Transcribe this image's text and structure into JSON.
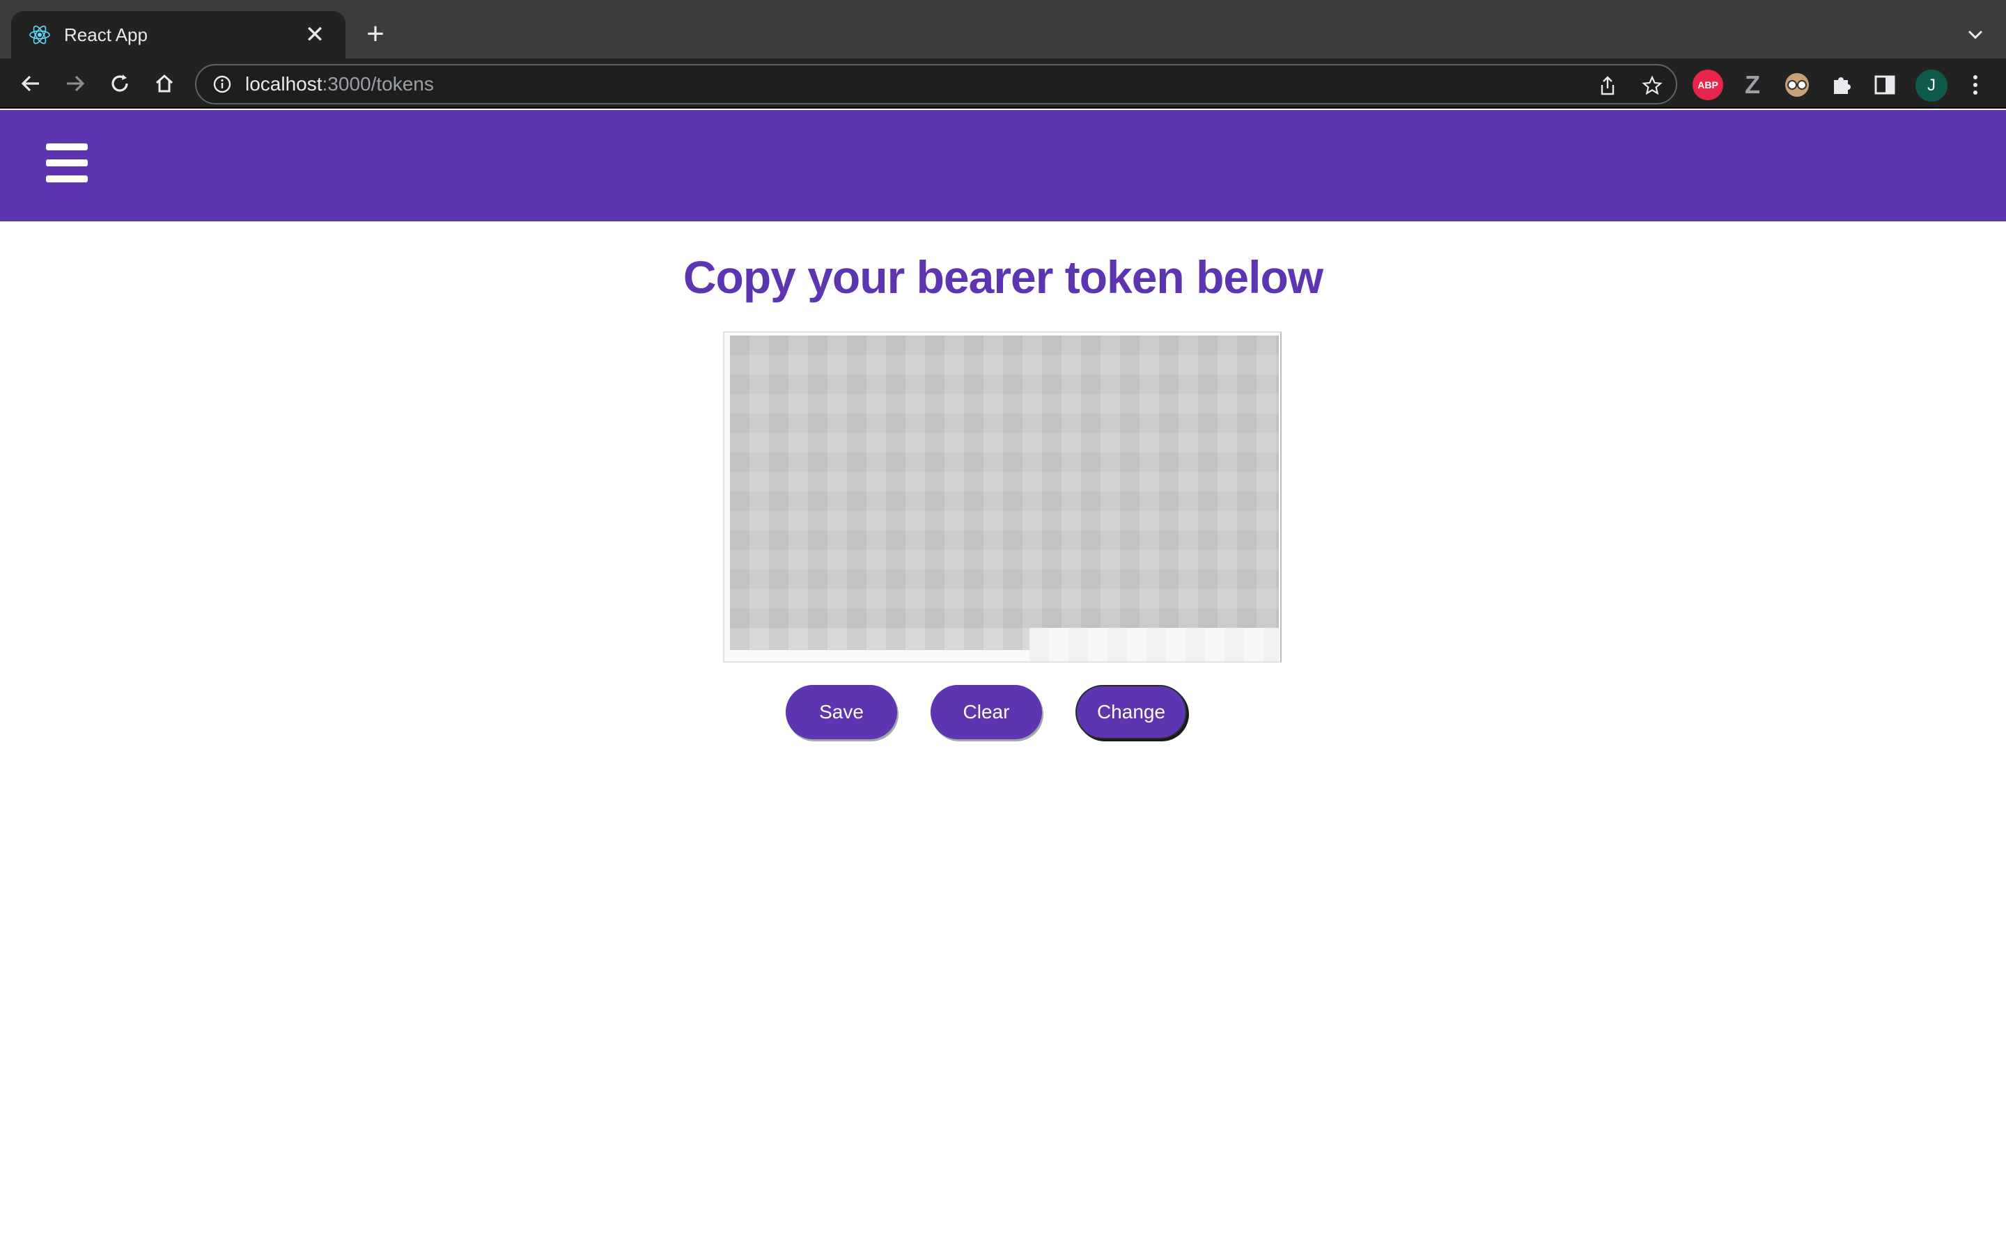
{
  "browser": {
    "tab": {
      "title": "React App",
      "favicon": "react-icon"
    },
    "address": {
      "host": "localhost",
      "rest": ":3000/tokens"
    },
    "extensions": [
      {
        "name": "adblock-icon",
        "label": "ABP",
        "color": "#e8254a"
      },
      {
        "name": "zotero-icon",
        "label": "Z",
        "color": "#9aa0a6"
      },
      {
        "name": "glasses-icon",
        "label": "",
        "color": "#c9a27a"
      },
      {
        "name": "puzzle-icon",
        "label": "",
        "color": "#e8eaed"
      },
      {
        "name": "sidepanel-icon",
        "label": "",
        "color": "#e8eaed"
      }
    ],
    "profile": {
      "initial": "J",
      "color": "#0f5a4a"
    }
  },
  "app": {
    "header_color": "#5e35b1",
    "menu_icon": "hamburger-icon"
  },
  "main": {
    "title": "Copy your bearer token below",
    "token_value": "",
    "buttons": {
      "save": "Save",
      "clear": "Clear",
      "change": "Change"
    }
  }
}
